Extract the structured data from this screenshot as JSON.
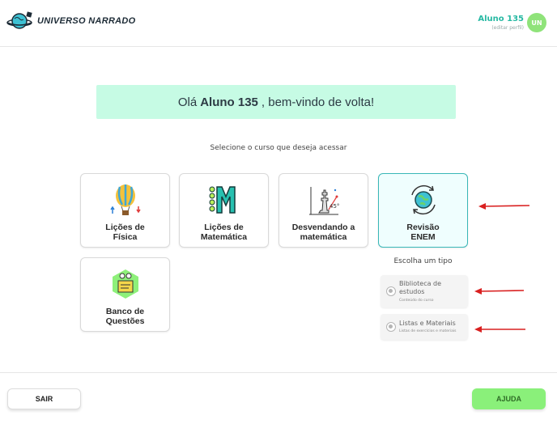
{
  "header": {
    "logo_text": "UNIVERSO NARRADO",
    "user_name": "Aluno 135",
    "edit_profile": "(editar perfil)",
    "avatar_initials": "UN"
  },
  "welcome": {
    "prefix": "Olá",
    "name": "Aluno 135",
    "suffix": ", bem-vindo de volta!"
  },
  "prompt": "Selecione o curso que deseja acessar",
  "courses": [
    {
      "line1": "Lições de",
      "line2": "Física",
      "icon": "hot-air-balloon-icon",
      "selected": false
    },
    {
      "line1": "Lições de",
      "line2": "Matemática",
      "icon": "letter-m-icon",
      "selected": false
    },
    {
      "line1": "Desvendando a",
      "line2": "matemática",
      "icon": "chess-math-icon",
      "selected": false
    },
    {
      "line1": "Revisão",
      "line2": "ENEM",
      "icon": "globe-cycle-icon",
      "selected": true
    },
    {
      "line1": "Banco de",
      "line2": "Questões",
      "icon": "question-bank-icon",
      "selected": false
    }
  ],
  "type_section": {
    "title": "Escolha um tipo",
    "options": [
      {
        "title_line1": "Biblioteca de",
        "title_line2": "estudos",
        "subtitle": "Conteúdo do curso"
      },
      {
        "title_line1": "Listas e Materiais",
        "title_line2": "",
        "subtitle": "Listas de exercícios e materiais"
      }
    ]
  },
  "footer": {
    "exit_label": "SAIR",
    "help_label": "AJUDA"
  },
  "colors": {
    "accent": "#27b9a3",
    "welcome_bg": "#c6fbe4",
    "selected_border": "#39b7b7",
    "help_button": "#8af07a",
    "arrow": "#d92020"
  }
}
